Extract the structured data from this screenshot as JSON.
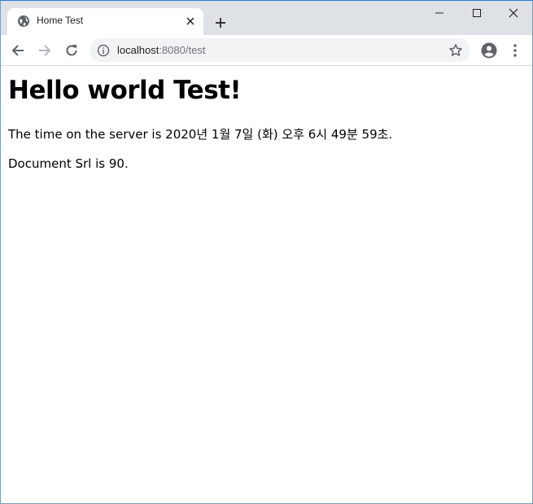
{
  "browser": {
    "tab": {
      "title": "Home Test",
      "favicon": "globe-icon"
    },
    "address_bar": {
      "host": "localhost",
      "rest": ":8080/test"
    },
    "icons": {
      "back": "back-arrow-icon",
      "forward": "forward-arrow-icon",
      "reload": "reload-icon",
      "info": "info-icon",
      "bookmark": "star-icon",
      "profile": "account-icon",
      "menu": "kebab-menu-icon",
      "new_tab": "plus-icon"
    },
    "colors": {
      "tabstrip": "#dee1e6",
      "omnibox": "#f1f3f4",
      "icon": "#5f6368",
      "forward_disabled": "#b4b7bb"
    }
  },
  "page": {
    "heading": "Hello world Test!",
    "server_time_text": "The time on the server is 2020년 1월 7일 (화) 오후 6시 49분 59초.",
    "document_srl_text": "Document Srl is 90."
  }
}
